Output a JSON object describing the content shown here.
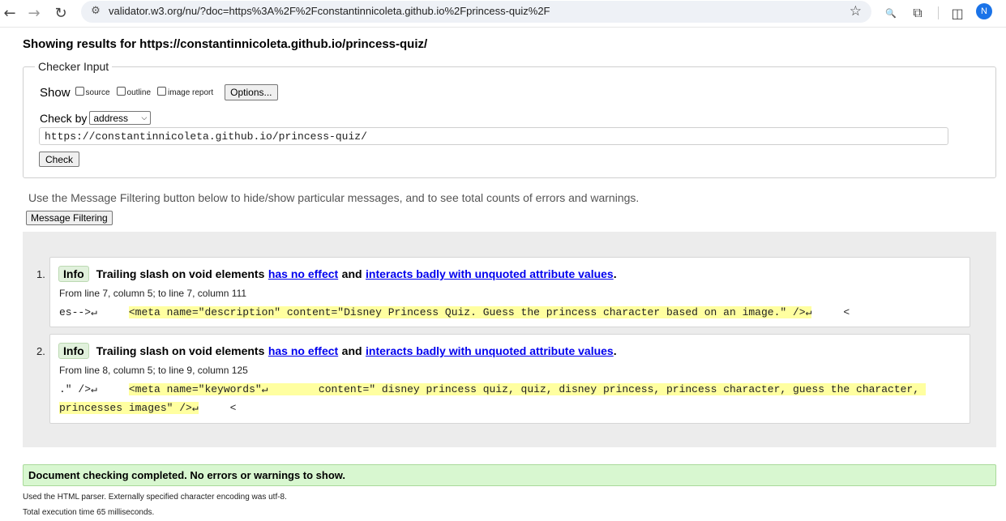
{
  "browser": {
    "url": "validator.w3.org/nu/?doc=https%3A%2F%2Fconstantinnicoleta.github.io%2Fprincess-quiz%2F",
    "profile_initial": "N",
    "icons": {
      "back": "←",
      "forward": "→",
      "reload": "↻",
      "site_settings": "⚙",
      "bookmark": "☆",
      "zoom": "🔍",
      "extensions": "⧉",
      "sidepanel": "◫"
    }
  },
  "page": {
    "heading": "Showing results for https://constantinnicoleta.github.io/princess-quiz/"
  },
  "checker": {
    "legend": "Checker Input",
    "show_label": "Show",
    "options": [
      "source",
      "outline",
      "image report"
    ],
    "options_button": "Options...",
    "checkby_label": "Check by",
    "checkby_value": "address",
    "url_value": "https://constantinnicoleta.github.io/princess-quiz/",
    "check_button": "Check"
  },
  "filter": {
    "hint": "Use the Message Filtering button below to hide/show particular messages, and to see total counts of errors and warnings.",
    "button": "Message Filtering"
  },
  "messages": [
    {
      "number": "1.",
      "type": "Info",
      "title": "Trailing slash on void elements",
      "link1": "has no effect",
      "middle": "and",
      "link2": "interacts badly with unquoted attribute values",
      "period": ".",
      "location_prefix": "From line ",
      "from_line": "7",
      "from_col_text": ", column 5; to line ",
      "to_line": "7",
      "to_col_text": ", column 111",
      "code_pre": "es-->↵     ",
      "code_highlight": "<meta name=\"description\" content=\"Disney Princess Quiz. Guess the princess character based on an image.\" />↵",
      "code_post": "     <"
    },
    {
      "number": "2.",
      "type": "Info",
      "title": "Trailing slash on void elements",
      "link1": "has no effect",
      "middle": "and",
      "link2": "interacts badly with unquoted attribute values",
      "period": ".",
      "location_prefix": "From line ",
      "from_line": "8",
      "from_col_text": ", column 5; to line ",
      "to_line": "9",
      "to_col_text": ", column 125",
      "code_pre": ".\" />↵     ",
      "code_highlight": "<meta name=\"keywords\"↵        content=\" disney princess quiz, quiz, disney princess, princess character, guess the character, princesses images\" />↵",
      "code_post": "     <"
    }
  ],
  "status": {
    "done": "Document checking completed. No errors or warnings to show.",
    "parser": "Used the HTML parser. Externally specified character encoding was utf-8.",
    "exec": "Total execution time 65 milliseconds."
  }
}
